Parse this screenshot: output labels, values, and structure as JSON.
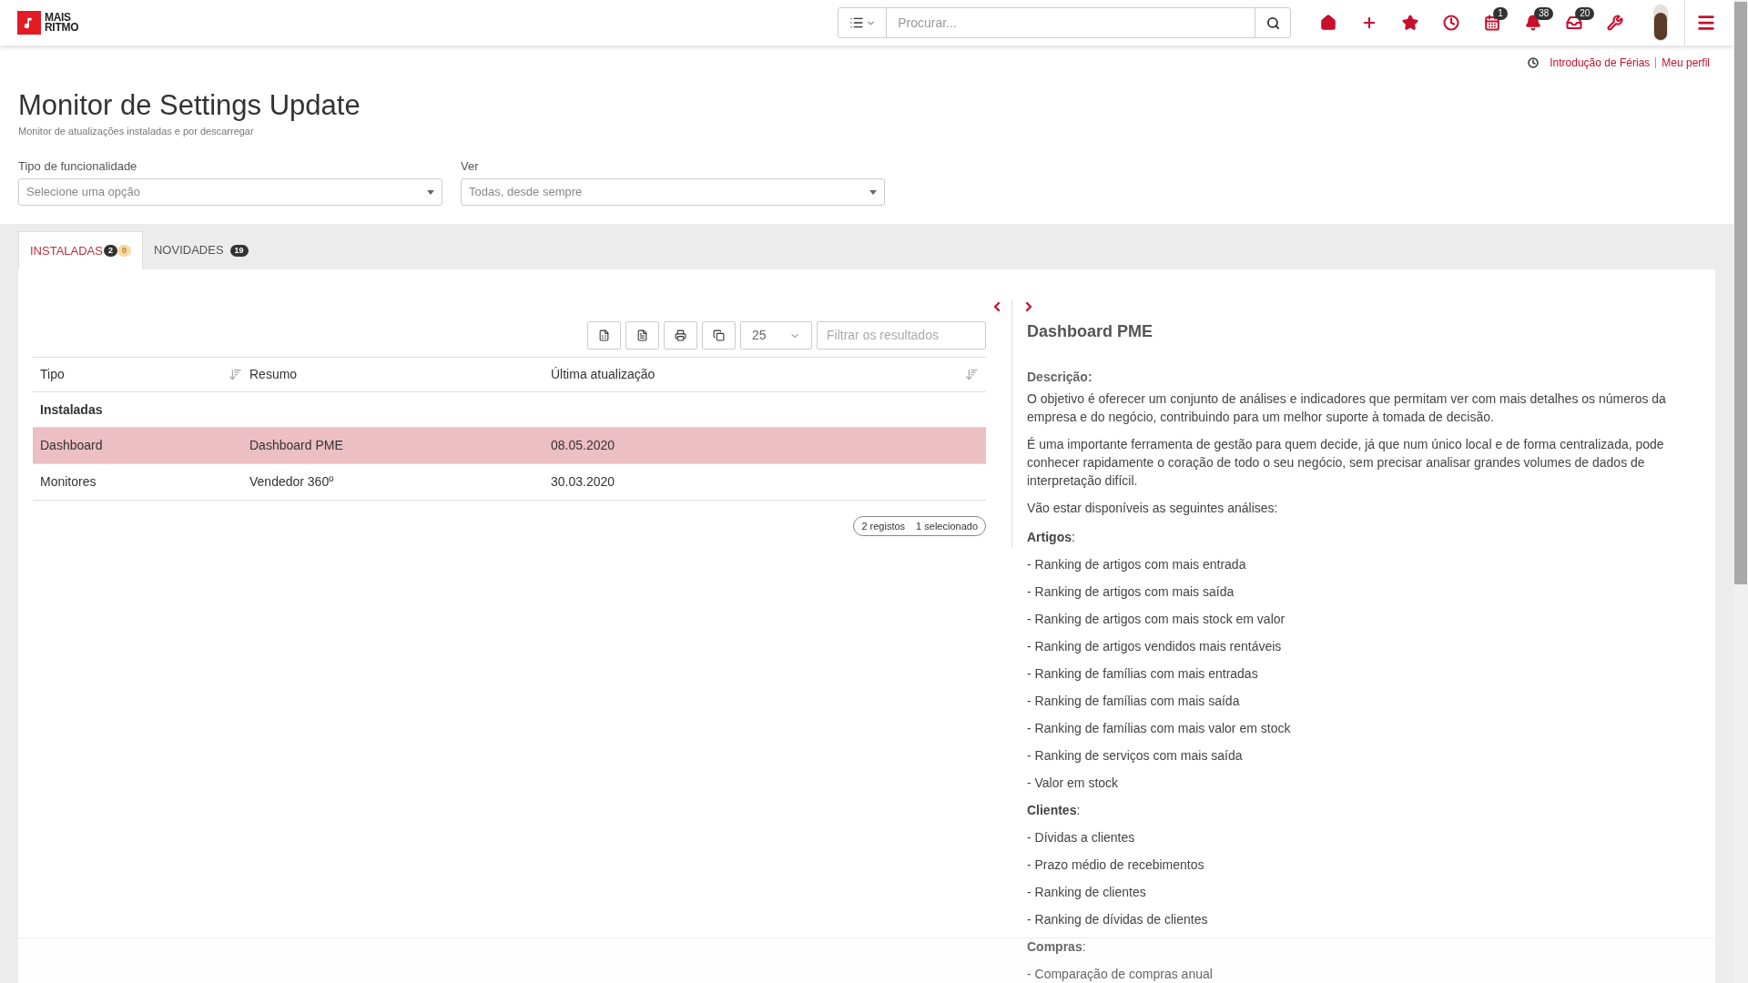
{
  "brand": {
    "line_1": "MAIS",
    "line_2": "RITMO"
  },
  "search": {
    "placeholder": "Procurar..."
  },
  "toolbar_icons": [
    {
      "kind": "home"
    },
    {
      "kind": "plus"
    },
    {
      "kind": "star"
    },
    {
      "kind": "clock"
    },
    {
      "kind": "calendar",
      "badge": "1"
    },
    {
      "kind": "bell",
      "badge": "38"
    },
    {
      "kind": "tray",
      "badge": "20"
    },
    {
      "kind": "wrench"
    }
  ],
  "links": [
    "Introdução de Férias",
    "Meu perfil"
  ],
  "page": {
    "title": "Monitor de Settings Update",
    "subtitle": "Monitor de atualizações instaladas e por descarregar"
  },
  "filters": [
    {
      "label": "Tipo de funcionalidade",
      "placeholder": "Selecione uma opção"
    },
    {
      "label": "Ver",
      "value": "Todas, desde sempre"
    }
  ],
  "tabs": [
    {
      "label": "INSTALADAS",
      "selected": true,
      "badges": [
        {
          "text": "2",
          "color": "#333333"
        },
        {
          "text": "0",
          "color": "#fcd9a5"
        }
      ]
    },
    {
      "label": "NOVIDADES",
      "selected": false,
      "badges": [
        {
          "text": "19",
          "color": "#333333"
        }
      ]
    }
  ],
  "page_size": "25",
  "filter_placeholder": "Filtrar os resultados",
  "table": {
    "columns": [
      "Tipo",
      "Resumo",
      "Última atualização"
    ],
    "group": "Instaladas",
    "rows": [
      {
        "cells": [
          "Dashboard",
          "Dashboard PME",
          "08.05.2020"
        ],
        "selected": true
      },
      {
        "cells": [
          "Monitores",
          "Vendedor 360º",
          "30.03.2020"
        ],
        "selected": false
      }
    ]
  },
  "summary": {
    "count": "2 registos",
    "selected": "1 selecionado"
  },
  "detail": {
    "title": "Dashboard PME",
    "description_label": "Descrição:",
    "paragraphs": [
      "O objetivo é oferecer um conjunto de análises e indicadores que permitam ver com mais detalhes os números da empresa e do negócio, contribuindo para um melhor suporte à tomada de decisão.",
      "É uma importante ferramenta de gestão para quem decide, já que num único local e de forma centralizada, pode conhecer rapidamente o coração de todo o seu negócio, sem precisar analisar grandes volumes de dados de interpretação difícil.",
      "Vão estar disponíveis as seguintes análises:"
    ],
    "sections": [
      {
        "heading": "**Artigos**:",
        "items": [
          "- Ranking de artigos com mais entrada",
          "- Ranking de artigos com mais saída",
          "- Ranking de artigos com mais stock em valor",
          "- Ranking de artigos vendidos mais rentáveis",
          "- Ranking de famílias com mais entradas",
          "- Ranking de famílias com mais saída",
          "- Ranking de famílias com mais valor em stock",
          "- Ranking de serviços com mais saída",
          "- Valor em stock"
        ]
      },
      {
        "heading": "**Clientes**:",
        "items": [
          "- Dívidas a clientes",
          "- Prazo médio de recebimentos",
          "- Ranking de clientes",
          "- Ranking de dívidas de clientes"
        ]
      },
      {
        "heading": "**Compras**:",
        "items": [
          "- Comparação de compras anual"
        ]
      }
    ]
  }
}
